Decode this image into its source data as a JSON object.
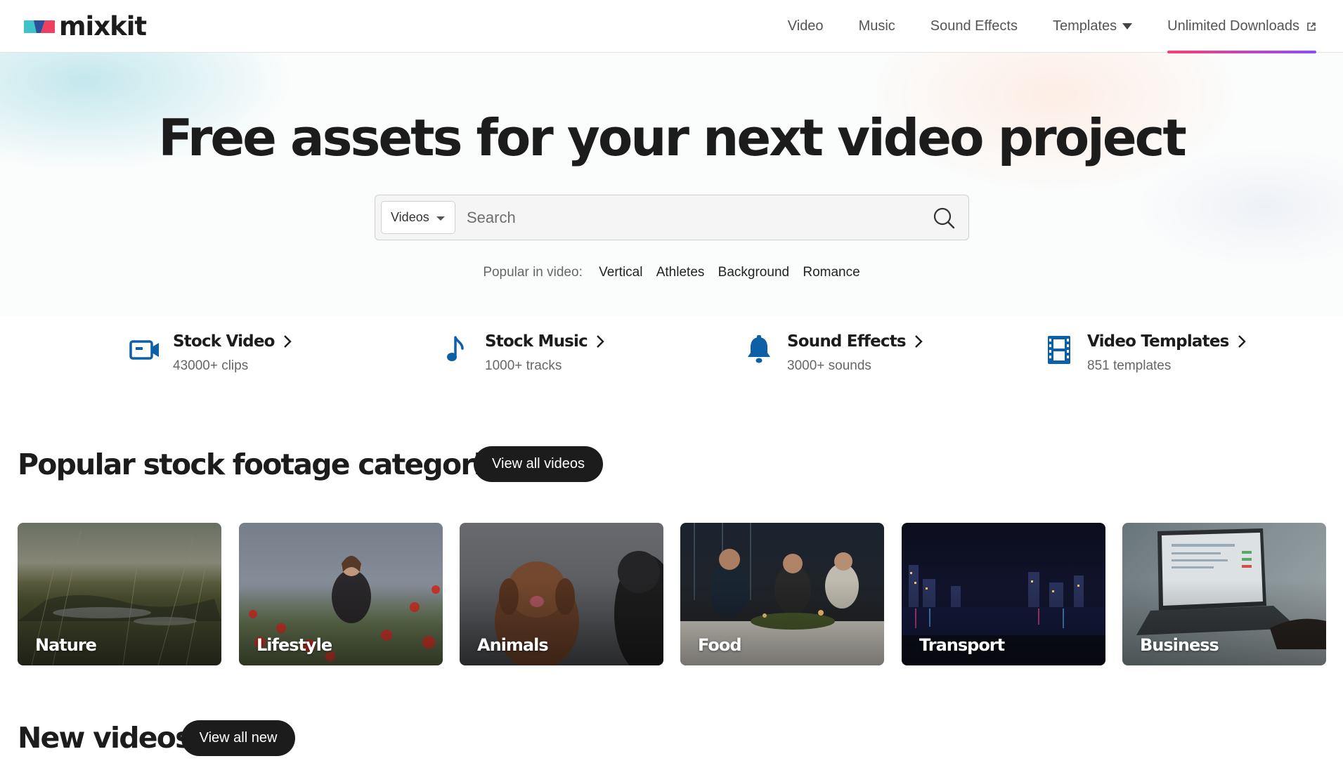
{
  "brand": {
    "name": "mixkit"
  },
  "nav": {
    "items": [
      {
        "label": "Video"
      },
      {
        "label": "Music"
      },
      {
        "label": "Sound Effects"
      },
      {
        "label": "Templates"
      },
      {
        "label": "Unlimited Downloads"
      }
    ]
  },
  "hero": {
    "title": "Free assets for your next video project",
    "search": {
      "type_selected": "Videos",
      "placeholder": "Search",
      "value": ""
    },
    "popular": {
      "label": "Popular in video:",
      "links": [
        "Vertical",
        "Athletes",
        "Background",
        "Romance"
      ]
    }
  },
  "categories": [
    {
      "title": "Stock Video",
      "subtitle": "43000+ clips",
      "icon": "video-camera-icon"
    },
    {
      "title": "Stock Music",
      "subtitle": "1000+ tracks",
      "icon": "music-note-icon"
    },
    {
      "title": "Sound Effects",
      "subtitle": "3000+ sounds",
      "icon": "bell-icon"
    },
    {
      "title": "Video Templates",
      "subtitle": "851 templates",
      "icon": "film-strip-icon"
    }
  ],
  "popular_section": {
    "title": "Popular stock footage categories",
    "button": "View all videos",
    "cards": [
      {
        "label": "Nature"
      },
      {
        "label": "Lifestyle"
      },
      {
        "label": "Animals"
      },
      {
        "label": "Food"
      },
      {
        "label": "Transport"
      },
      {
        "label": "Business"
      }
    ]
  },
  "new_section": {
    "title": "New videos",
    "button": "View all new"
  },
  "colors": {
    "accent_icon": "#0d5fa6",
    "dark": "#1c1c1c",
    "underline_start": "#ff3d6e",
    "underline_end": "#8a4dff"
  }
}
